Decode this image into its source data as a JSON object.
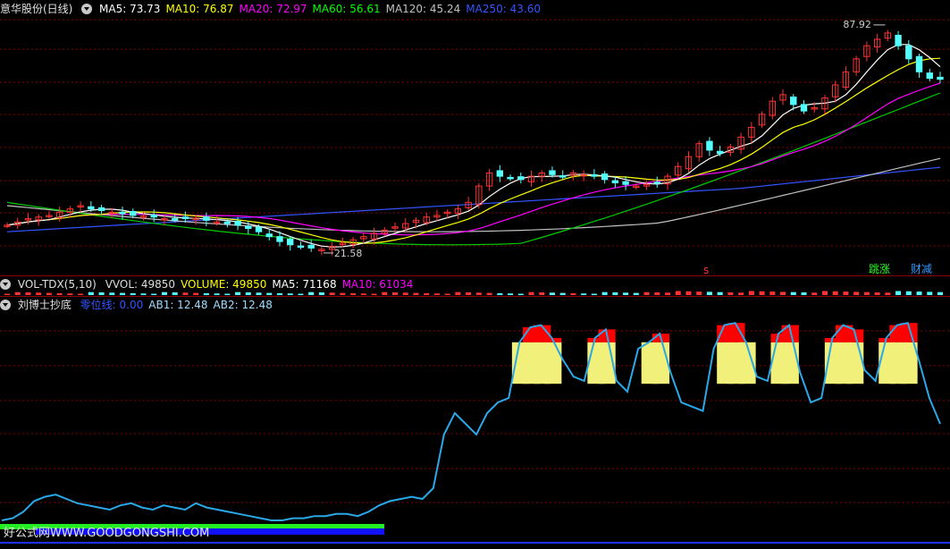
{
  "main_panel": {
    "title": "意华股份(日线)",
    "indicators": [
      {
        "label": "MA5: 73.73",
        "color": "#ffffff"
      },
      {
        "label": "MA10: 76.87",
        "color": "#ffff00"
      },
      {
        "label": "MA20: 72.97",
        "color": "#ff00ff"
      },
      {
        "label": "MA60: 56.61",
        "color": "#00ff00"
      },
      {
        "label": "MA120: 45.24",
        "color": "#c0c0c0"
      },
      {
        "label": "MA250: 43.60",
        "color": "#3355ff"
      }
    ],
    "high_label": "87.92",
    "low_label": "21.58",
    "signals": {
      "s": "s",
      "tiaozhang": "跳涨",
      "caijian": "财减"
    }
  },
  "vol_panel": {
    "title": "VOL-TDX(5,10)",
    "indicators": [
      {
        "label": "VVOL: 49850",
        "color": "#dddddd"
      },
      {
        "label": "VOLUME: 49850",
        "color": "#ffff00"
      },
      {
        "label": "MA5: 71168",
        "color": "#ffffff"
      },
      {
        "label": "MA10: 61034",
        "color": "#ff00ff"
      }
    ]
  },
  "ind_panel": {
    "title": "刘博士抄底",
    "indicators": [
      {
        "label": "零位线: 0.00",
        "color": "#3355ff"
      },
      {
        "label": "AB1: 12.48",
        "color": "#9fdcff"
      },
      {
        "label": "AB2: 12.48",
        "color": "#9fdcff"
      }
    ]
  },
  "watermark": "好公式网WWW.GOODGONGSHI.COM",
  "colors": {
    "up": "#ff3333",
    "down": "#54ffff",
    "grid": "#8a0000",
    "ab_line": "#2aa8e8",
    "band_yellow": "#f0f07a",
    "band_red": "#ff0000"
  },
  "chart_data": {
    "type": "line",
    "title": "意华股份(日线)",
    "price_markers": {
      "high": 87.92,
      "low": 21.58
    },
    "ma_latest": {
      "MA5": 73.73,
      "MA10": 76.87,
      "MA20": 72.97,
      "MA60": 56.61,
      "MA120": 45.24,
      "MA250": 43.6
    },
    "volume_latest": {
      "VVOL": 49850,
      "VOLUME": 49850,
      "MA5": 71168,
      "MA10": 61034
    },
    "indicator_latest": {
      "零位线": 0.0,
      "AB1": 12.48,
      "AB2": 12.48
    },
    "close_series": [
      29,
      30,
      31,
      31.5,
      32,
      33,
      34,
      35,
      34,
      33.5,
      33,
      32.5,
      32,
      31.8,
      31.5,
      31,
      30.8,
      31,
      31.2,
      30.5,
      30,
      29.5,
      29,
      28,
      27,
      25.5,
      24,
      23,
      22.5,
      22,
      21.58,
      22.5,
      23.5,
      24.5,
      25.5,
      26.5,
      27.5,
      28.5,
      29.5,
      30.5,
      31.5,
      32,
      33,
      34,
      36,
      41,
      45,
      44,
      43.5,
      43,
      44,
      45,
      44.5,
      44,
      45,
      44.5,
      44,
      43,
      42,
      41.5,
      41,
      41.5,
      42,
      44,
      47,
      50,
      54,
      52,
      51,
      53,
      56,
      59,
      63,
      67,
      69,
      66,
      64,
      65,
      68,
      72,
      76,
      80,
      84,
      86,
      87.92,
      84,
      80,
      76,
      74,
      73.73
    ],
    "ab_series": [
      5,
      6,
      9,
      14,
      16,
      17,
      15,
      13,
      12,
      11,
      10,
      12,
      13,
      11,
      10,
      12,
      11,
      10,
      13,
      11,
      10,
      9,
      8,
      7,
      6,
      5,
      5,
      6,
      6,
      7,
      7,
      8,
      8,
      7,
      9,
      12,
      14,
      15,
      16,
      15,
      20,
      45,
      55,
      50,
      45,
      55,
      60,
      62,
      88,
      95,
      96,
      90,
      80,
      72,
      70,
      90,
      94,
      70,
      65,
      85,
      88,
      92,
      74,
      60,
      58,
      56,
      85,
      96,
      97,
      88,
      72,
      70,
      92,
      96,
      74,
      60,
      62,
      90,
      96,
      94,
      75,
      70,
      90,
      96,
      97,
      80,
      62,
      50
    ]
  }
}
